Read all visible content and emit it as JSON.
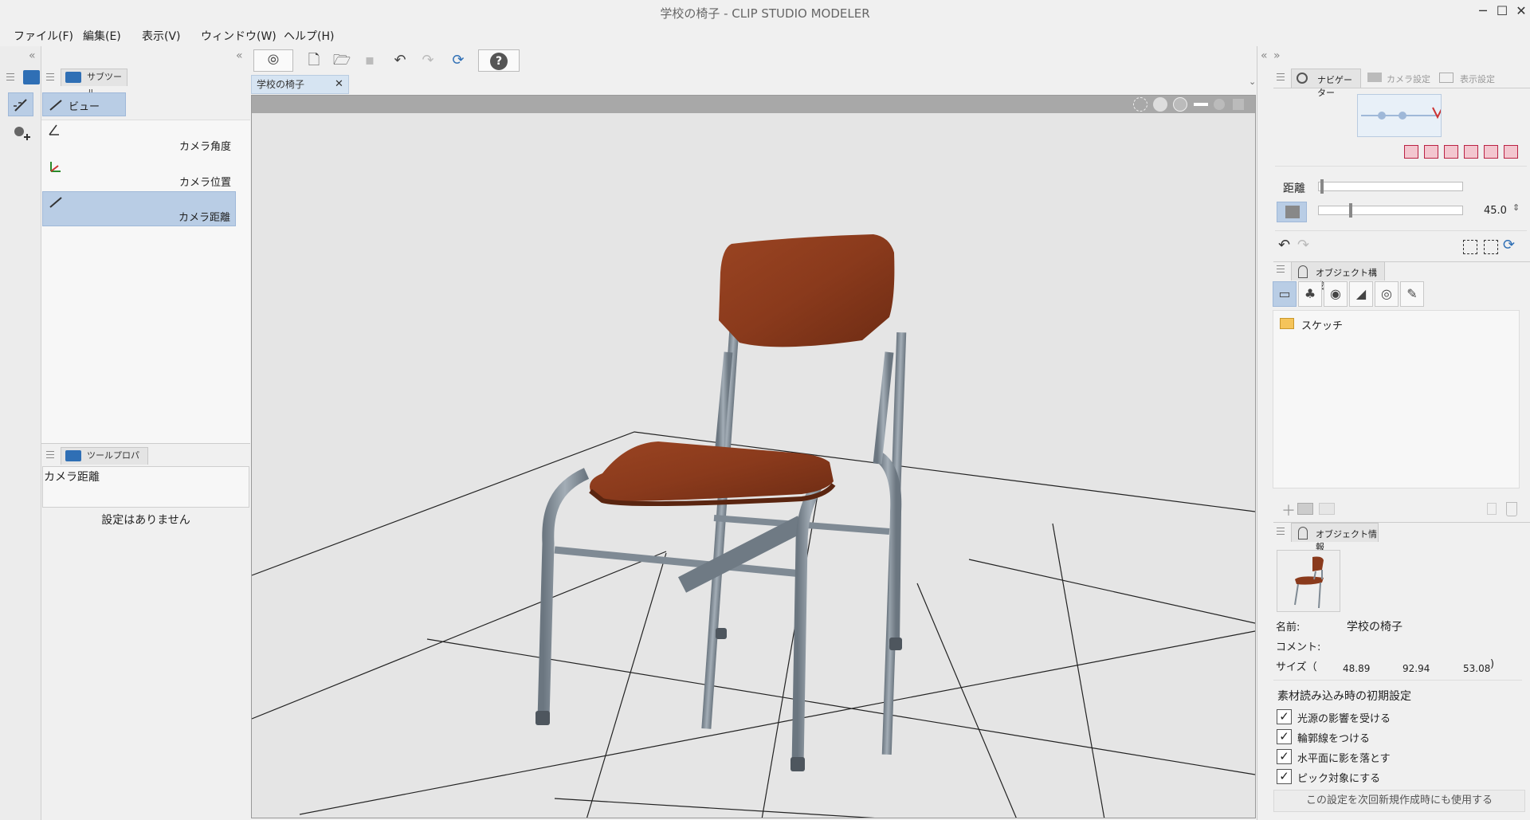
{
  "window": {
    "title": "学校の椅子 - CLIP STUDIO MODELER",
    "minimize": "─",
    "maximize": "☐",
    "close": "✕"
  },
  "menu": [
    "ファイル(F)",
    "編集(E)",
    "表示(V)",
    "ウィンドウ(W)",
    "ヘルプ(H)"
  ],
  "subtool": {
    "tab_label": "サブツール",
    "group_label": "ビュー",
    "items": [
      "カメラ角度",
      "カメラ位置",
      "カメラ距離"
    ],
    "selected": "カメラ距離"
  },
  "tool_property": {
    "tab_label": "ツールプロパティ",
    "tool_name": "カメラ距離",
    "message": "設定はありません"
  },
  "document": {
    "tab_label": "学校の椅子"
  },
  "navigator": {
    "tabs": [
      "ナビゲーター",
      "カメラ設定",
      "表示設定"
    ],
    "distance_label": "距離",
    "angle_value": "45.0"
  },
  "object_structure": {
    "tab_label": "オブジェクト構成",
    "items": [
      "スケッチ"
    ]
  },
  "object_info": {
    "tab_label": "オブジェクト情報",
    "name_label": "名前:",
    "name_value": "学校の椅子",
    "comment_label": "コメント:",
    "size_label": "サイズ（",
    "size_x": "48.89",
    "size_y": "92.94",
    "size_z": "53.08",
    "size_close": ")",
    "initial_settings_label": "素材読み込み時の初期設定",
    "options": [
      {
        "label": "光源の影響を受ける",
        "checked": true
      },
      {
        "label": "輪郭線をつける",
        "checked": true
      },
      {
        "label": "水平面に影を落とす",
        "checked": true
      },
      {
        "label": "ピック対象にする",
        "checked": true
      }
    ],
    "apply_button": "この設定を次回新規作成時にも使用する"
  },
  "colors": {
    "selection": "#b9cde5",
    "accent": "#2f6fb5",
    "wood": "#8a3a1c",
    "metal": "#7f8a94"
  }
}
